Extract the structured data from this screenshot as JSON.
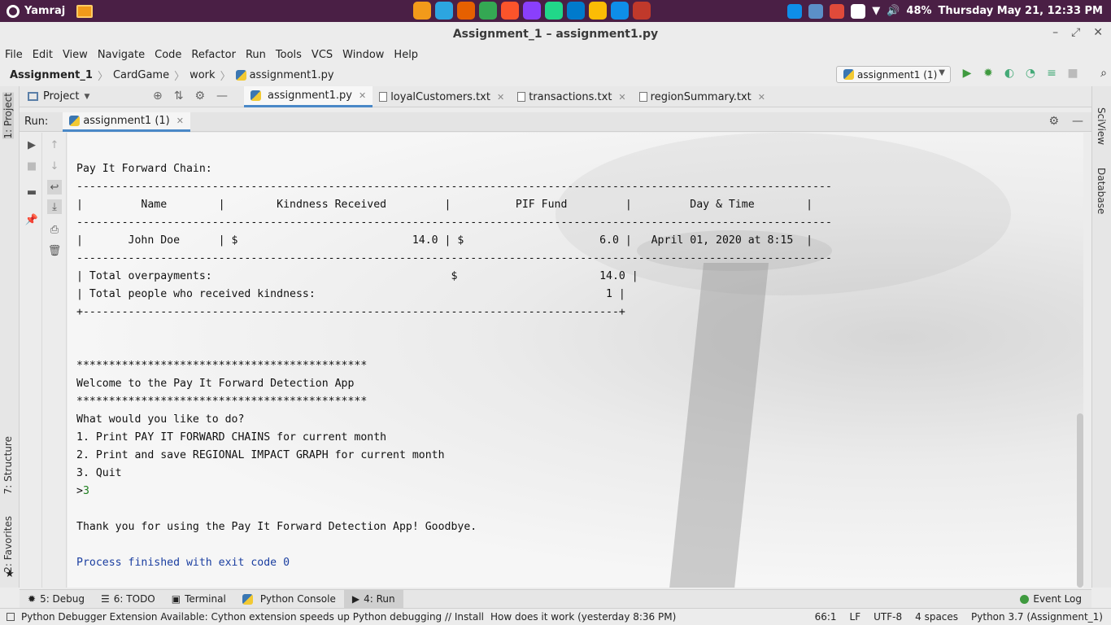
{
  "system": {
    "user": "Yamraj",
    "battery": "48%",
    "datetime": "Thursday May 21, 12:33 PM",
    "app_icons": [
      {
        "name": "files-icon",
        "color": "#f29a1a"
      },
      {
        "name": "telegram-icon",
        "color": "#2ca5e0"
      },
      {
        "name": "firefox-icon",
        "color": "#e66000"
      },
      {
        "name": "chrome-icon",
        "color": "#34a853"
      },
      {
        "name": "brave-icon",
        "color": "#fb542b"
      },
      {
        "name": "phpstorm-icon",
        "color": "#8a3ffc"
      },
      {
        "name": "pycharm-icon",
        "color": "#21d789"
      },
      {
        "name": "vscode-icon",
        "color": "#007acc"
      },
      {
        "name": "chrome-icon-2",
        "color": "#fbbc05"
      },
      {
        "name": "teamviewer-icon",
        "color": "#0e8ee9"
      },
      {
        "name": "document-viewer-icon",
        "color": "#c0392b"
      }
    ]
  },
  "window": {
    "title": "Assignment_1 – assignment1.py"
  },
  "menu": [
    "File",
    "Edit",
    "View",
    "Navigate",
    "Code",
    "Refactor",
    "Run",
    "Tools",
    "VCS",
    "Window",
    "Help"
  ],
  "breadcrumb": [
    "Assignment_1",
    "CardGame",
    "work",
    "assignment1.py"
  ],
  "run_config": "assignment1 (1)",
  "left_tabs": {
    "project": "1: Project",
    "structure": "7: Structure",
    "favorites": "2: Favorites"
  },
  "right_tabs": {
    "sciview": "SciView",
    "database": "Database"
  },
  "project_panel": {
    "title": "Project"
  },
  "editor_tabs": [
    {
      "label": "assignment1.py",
      "active": true
    },
    {
      "label": "loyalCustomers.txt",
      "active": false
    },
    {
      "label": "transactions.txt",
      "active": false
    },
    {
      "label": "regionSummary.txt",
      "active": false
    }
  ],
  "run_panel": {
    "label": "Run:",
    "tab": "assignment1 (1)"
  },
  "console": {
    "lines": [
      "Pay It Forward Chain:",
      "---------------------------------------------------------------------------------------------------------------------",
      "|         Name        |        Kindness Received         |          PIF Fund         |         Day & Time        |",
      "---------------------------------------------------------------------------------------------------------------------",
      "|       John Doe      | $                           14.0 | $                     6.0 |   April 01, 2020 at 8:15  |",
      "---------------------------------------------------------------------------------------------------------------------",
      "| Total overpayments:                                     $                      14.0 |",
      "| Total people who received kindness:                                             1 |",
      "+-----------------------------------------------------------------------------------+",
      "",
      "",
      "*********************************************",
      "Welcome to the Pay It Forward Detection App",
      "*********************************************",
      "What would you like to do?",
      "1. Print PAY IT FORWARD CHAINS for current month",
      "2. Print and save REGIONAL IMPACT GRAPH for current month",
      "3. Quit"
    ],
    "prompt": ">",
    "input": "3",
    "after_lines": [
      "",
      "Thank you for using the Pay It Forward Detection App! Goodbye.",
      ""
    ],
    "exit": "Process finished with exit code 0"
  },
  "bottom_tabs": [
    {
      "label": "5: Debug",
      "icon": "bug-icon",
      "active": false
    },
    {
      "label": "6: TODO",
      "icon": "list-icon",
      "active": false
    },
    {
      "label": "Terminal",
      "icon": "terminal-icon",
      "active": false
    },
    {
      "label": "Python Console",
      "icon": "python-icon",
      "active": false
    },
    {
      "label": "4: Run",
      "icon": "run-icon",
      "active": true
    }
  ],
  "event_log": "Event Log",
  "status": {
    "message": "Python Debugger Extension Available: Cython extension speeds up Python debugging // Install",
    "how": "How does it work (yesterday 8:36 PM)",
    "position": "66:1",
    "line_sep": "LF",
    "encoding": "UTF-8",
    "indent": "4 spaces",
    "interpreter": "Python 3.7 (Assignment_1)"
  }
}
